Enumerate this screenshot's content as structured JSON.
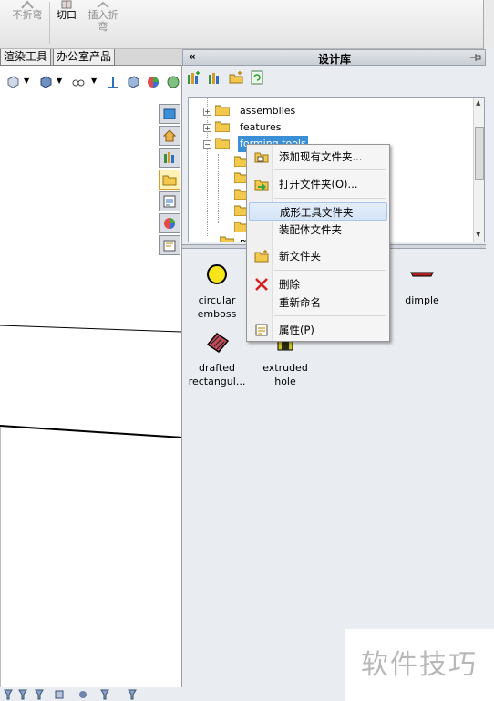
{
  "ribbon": {
    "buttons": [
      {
        "label": "不折弯",
        "icon": "unfold-icon"
      },
      {
        "label": "切口",
        "icon": "rip-icon"
      },
      {
        "label": "插入折",
        "label2": "弯",
        "icon": "insert-bends-icon"
      }
    ]
  },
  "tabs": [
    {
      "label": "渲染工具"
    },
    {
      "label": "办公室产品"
    }
  ],
  "panel": {
    "title": "设计库",
    "collapse_symbol": "«"
  },
  "tree": {
    "items": [
      {
        "label": "assemblies",
        "expander": "+"
      },
      {
        "label": "features",
        "expander": "+"
      },
      {
        "label": "forming tools",
        "expander": "−"
      },
      {
        "label": "m"
      }
    ]
  },
  "context_menu": {
    "items": [
      {
        "label": "添加现有文件夹...",
        "icon": "add-existing-folder-icon"
      },
      {
        "label": "打开文件夹(O)...",
        "icon": "open-folder-icon"
      },
      {
        "label": "成形工具文件夹",
        "icon": ""
      },
      {
        "label": "装配体文件夹",
        "icon": ""
      },
      {
        "label": "新文件夹",
        "icon": "new-folder-icon"
      },
      {
        "label": "删除",
        "icon": "delete-x-icon"
      },
      {
        "label": "重新命名",
        "icon": ""
      },
      {
        "label": "属性(P)",
        "icon": "properties-icon"
      }
    ],
    "highlighted": "成形工具文件夹"
  },
  "items": [
    {
      "line1": "circular",
      "line2": "emboss",
      "icon": "circular-emboss-icon"
    },
    {
      "line1": "dimple",
      "line2": "",
      "icon": "dimple-icon"
    },
    {
      "line1": "drafted",
      "line2": "rectangul...",
      "icon": "drafted-rectangular-icon"
    },
    {
      "line1": "extruded",
      "line2": "hole",
      "icon": "extruded-hole-icon"
    }
  ],
  "watermark": "软件技巧",
  "colors": {
    "selection": "#3b8fd6",
    "menu_highlight": "#d4e4f7",
    "panel_bg": "#e9ecf1"
  }
}
